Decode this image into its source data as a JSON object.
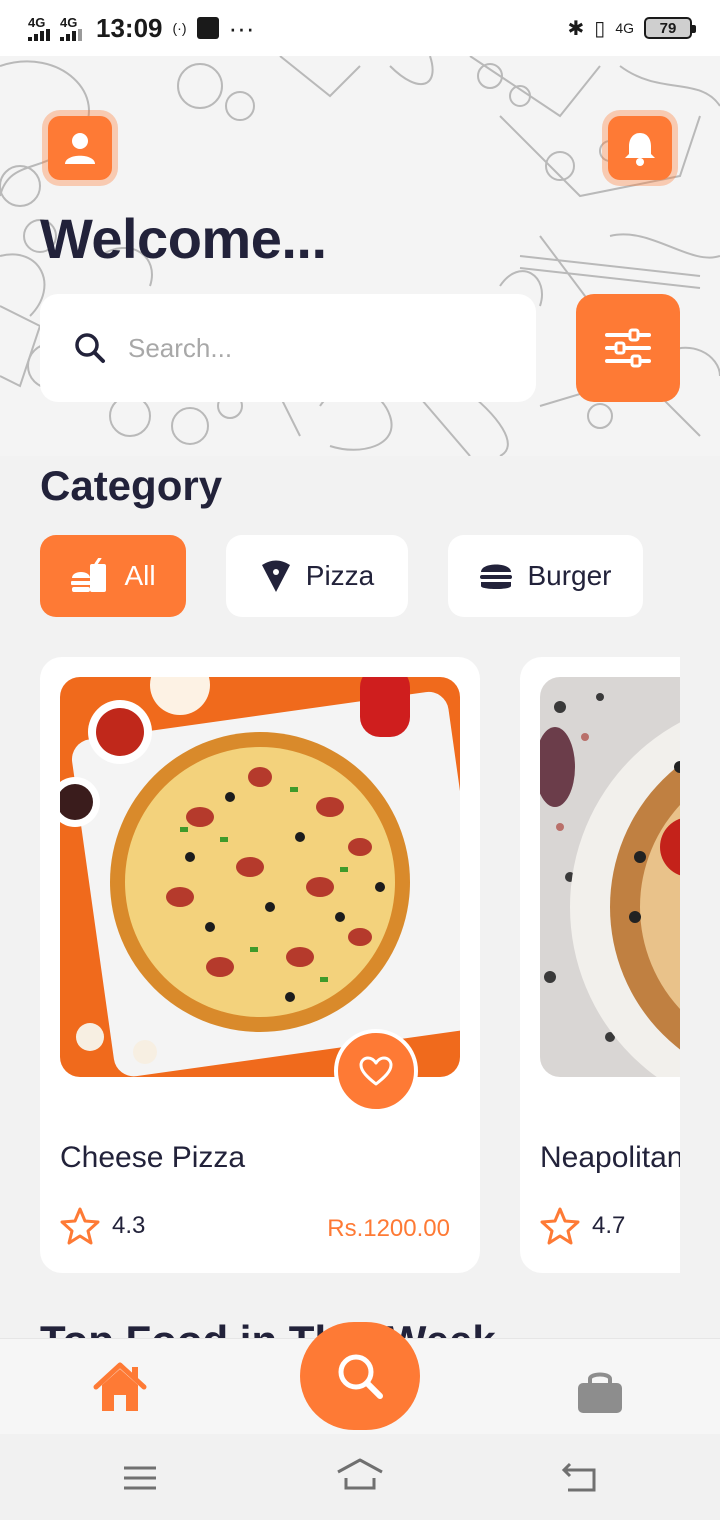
{
  "status_bar": {
    "network_1": "4G",
    "network_2": "4G",
    "time": "13:09",
    "extra_signal": "4G",
    "battery": "79"
  },
  "header": {
    "welcome": "Welcome...",
    "search_placeholder": "Search..."
  },
  "category": {
    "title": "Category",
    "chips": [
      {
        "label": "All",
        "icon": "fastfood-icon",
        "active": true
      },
      {
        "label": "Pizza",
        "icon": "pizza-slice-icon",
        "active": false
      },
      {
        "label": "Burger",
        "icon": "burger-icon",
        "active": false
      }
    ]
  },
  "products": [
    {
      "name": "Cheese Pizza",
      "rating": "4.3",
      "price": "Rs.1200.00"
    },
    {
      "name": "Neapolitan",
      "rating": "4.7"
    }
  ],
  "section2_title": "Top Food in This Week",
  "colors": {
    "accent": "#fe7a35",
    "text": "#22223a",
    "background": "#f2f2f2"
  }
}
